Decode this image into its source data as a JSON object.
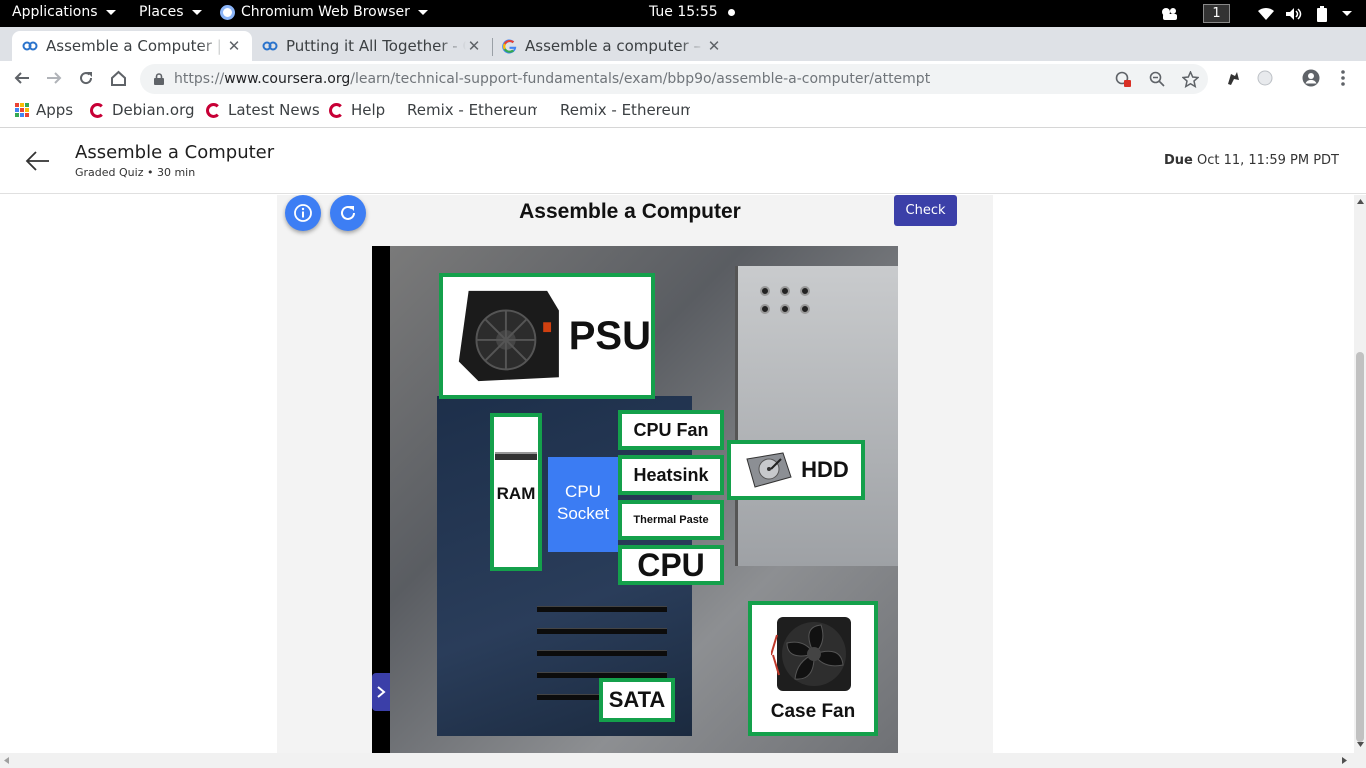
{
  "system_bar": {
    "applications": "Applications",
    "places": "Places",
    "active_app": "Chromium Web Browser",
    "clock": "Tue 15:55",
    "workspace": "1"
  },
  "tabs": [
    {
      "title": "Assemble a Computer | Co",
      "active": true
    },
    {
      "title": "Putting it All Together - G",
      "active": false
    },
    {
      "title": "Assemble a computer – G",
      "active": false
    }
  ],
  "address_bar": {
    "url_prefix": "https://",
    "url_host": "www.coursera.org",
    "url_path": "/learn/technical-support-fundamentals/exam/bbp9o/assemble-a-computer/attempt"
  },
  "bookmarks": [
    {
      "label": "Apps",
      "icon": "apps-grid-icon"
    },
    {
      "label": "Debian.org",
      "icon": "debian-icon"
    },
    {
      "label": "Latest News",
      "icon": "debian-icon"
    },
    {
      "label": "Help",
      "icon": "debian-icon"
    },
    {
      "label": "Remix - Ethereum",
      "icon": "remix-icon"
    },
    {
      "label": "Remix - Ethereum",
      "icon": "remix-icon"
    }
  ],
  "header": {
    "title": "Assemble a Computer",
    "subtitle": "Graded Quiz • 30 min",
    "due_label": "Due",
    "due_date": "Oct 11, 11:59 PM PDT"
  },
  "quiz": {
    "title": "Assemble a Computer",
    "check_label": "Check",
    "socket_line1": "CPU",
    "socket_line2": "Socket",
    "components": {
      "psu": "PSU",
      "cpu_fan": "CPU Fan",
      "heatsink": "Heatsink",
      "thermal_paste": "Thermal Paste",
      "cpu": "CPU",
      "ram": "RAM",
      "hdd": "HDD",
      "sata": "SATA",
      "case_fan": "Case Fan"
    }
  },
  "colors": {
    "tile_border": "#14a04b",
    "socket": "#3b7cf3",
    "check_button": "#3b3fa8",
    "round_button": "#3d7ef4"
  }
}
